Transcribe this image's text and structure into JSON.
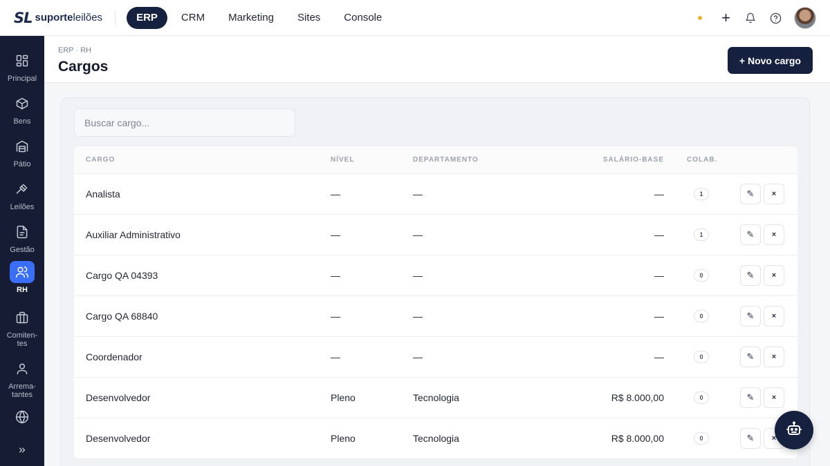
{
  "brand": {
    "mark": "SL",
    "name_bold": "suporte",
    "name_light": "leilões"
  },
  "topnav": [
    {
      "label": "ERP",
      "active": true
    },
    {
      "label": "CRM",
      "active": false
    },
    {
      "label": "Marketing",
      "active": false
    },
    {
      "label": "Sites",
      "active": false
    },
    {
      "label": "Console",
      "active": false
    }
  ],
  "topbar_icons": [
    "status-dot",
    "plus-icon",
    "bell-icon",
    "help-icon",
    "avatar"
  ],
  "sidebar": {
    "items": [
      {
        "label": "Principal",
        "icon": "grid-icon",
        "active": false
      },
      {
        "label": "Bens",
        "icon": "box-icon",
        "active": false
      },
      {
        "label": "Pátio",
        "icon": "warehouse-icon",
        "active": false
      },
      {
        "label": "Leilões",
        "icon": "gavel-icon",
        "active": false
      },
      {
        "label": "Gestão",
        "icon": "document-icon",
        "active": false
      },
      {
        "label": "RH",
        "icon": "users-icon",
        "active": true
      },
      {
        "label": "Comiten-tes",
        "icon": "briefcase-icon",
        "active": false
      },
      {
        "label": "Arrema-tantes",
        "icon": "user-icon",
        "active": false
      },
      {
        "label": "",
        "icon": "globe-icon",
        "active": false
      }
    ],
    "collapse_icon": "double-chevron-right-icon"
  },
  "header": {
    "breadcrumb": "ERP · RH",
    "title": "Cargos",
    "new_button": "+ Novo cargo"
  },
  "search": {
    "placeholder": "Buscar cargo...",
    "value": ""
  },
  "table": {
    "columns": [
      "CARGO",
      "NÍVEL",
      "DEPARTAMENTO",
      "SALÁRIO-BASE",
      "COLAB."
    ],
    "rows": [
      {
        "cargo": "Analista",
        "nivel": "—",
        "departamento": "—",
        "salario": "—",
        "colab": "1"
      },
      {
        "cargo": "Auxiliar Administrativo",
        "nivel": "—",
        "departamento": "—",
        "salario": "—",
        "colab": "1"
      },
      {
        "cargo": "Cargo QA 04393",
        "nivel": "—",
        "departamento": "—",
        "salario": "—",
        "colab": "0"
      },
      {
        "cargo": "Cargo QA 68840",
        "nivel": "—",
        "departamento": "—",
        "salario": "—",
        "colab": "0"
      },
      {
        "cargo": "Coordenador",
        "nivel": "—",
        "departamento": "—",
        "salario": "—",
        "colab": "0"
      },
      {
        "cargo": "Desenvolvedor",
        "nivel": "Pleno",
        "departamento": "Tecnologia",
        "salario": "R$ 8.000,00",
        "colab": "0"
      },
      {
        "cargo": "Desenvolvedor",
        "nivel": "Pleno",
        "departamento": "Tecnologia",
        "salario": "R$ 8.000,00",
        "colab": "0"
      }
    ],
    "edit_glyph": "✎",
    "delete_glyph": "×"
  },
  "assistant": {
    "icon": "robot-icon"
  }
}
